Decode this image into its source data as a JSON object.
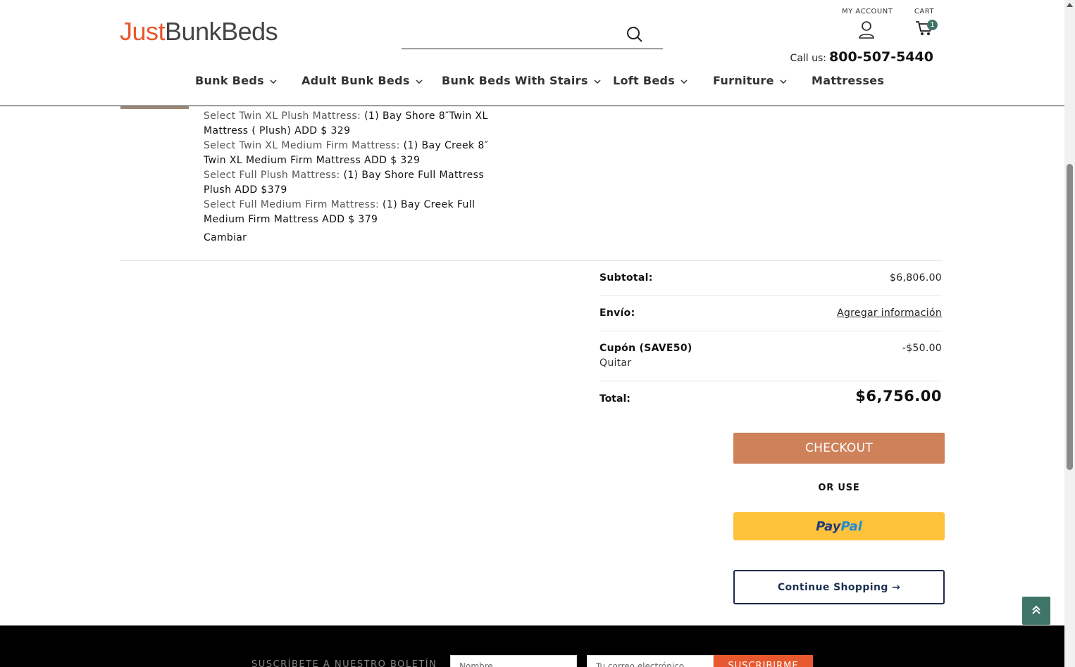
{
  "header": {
    "logo_part1": "Just",
    "logo_part2": "BunkBeds",
    "search_placeholder": "",
    "my_account_label": "MY ACCOUNT",
    "cart_label": "CART",
    "cart_count": "1",
    "call_us_label": "Call us:",
    "phone": "800-507-5440"
  },
  "nav": {
    "items": [
      {
        "label": "Bunk Beds",
        "has_dropdown": true
      },
      {
        "label": "Adult Bunk Beds",
        "has_dropdown": true
      },
      {
        "label": "Bunk Beds With Stairs",
        "has_dropdown": true
      },
      {
        "label": "Loft Beds",
        "has_dropdown": true
      },
      {
        "label": "Furniture",
        "has_dropdown": true
      },
      {
        "label": "Mattresses",
        "has_dropdown": false
      }
    ]
  },
  "cart_item": {
    "options": [
      {
        "label": "Select Twin XL Plush Mattress:",
        "value": "(1) Bay Shore 8″Twin XL Mattress ( Plush) ADD $ 329"
      },
      {
        "label": "Select Twin XL Medium Firm Mattress:",
        "value": "(1) Bay Creek 8″ Twin XL Medium Firm Mattress ADD $ 329"
      },
      {
        "label": "Select Full Plush Mattress:",
        "value": "(1) Bay Shore Full Mattress Plush ADD $379"
      },
      {
        "label": "Select Full Medium Firm Mattress:",
        "value": "(1) Bay Creek Full Medium Firm Mattress ADD $ 379"
      }
    ],
    "change_label": "Cambiar"
  },
  "totals": {
    "subtotal_label": "Subtotal:",
    "subtotal_value": "$6,806.00",
    "shipping_label": "Envío:",
    "shipping_link": "Agregar información",
    "coupon_label": "Cupón (SAVE50)",
    "coupon_value": "-$50.00",
    "coupon_remove": "Quitar",
    "total_label": "Total:",
    "total_value": "$6,756.00"
  },
  "actions": {
    "checkout": "CHECKOUT",
    "or_use": "OR USE",
    "paypal_a": "Pay",
    "paypal_b": "Pal",
    "continue": "Continue Shopping →"
  },
  "footer": {
    "newsletter_label": "SUSCRÍBETE A NUESTRO BOLETÍN",
    "name_placeholder": "Nombre",
    "email_placeholder": "Tu correo electrónico",
    "subscribe": "SUSCRIBIRME"
  },
  "colors": {
    "accent": "#e8582f",
    "checkout": "#cf8159",
    "paypal": "#fec33a",
    "teal": "#3f7568"
  }
}
